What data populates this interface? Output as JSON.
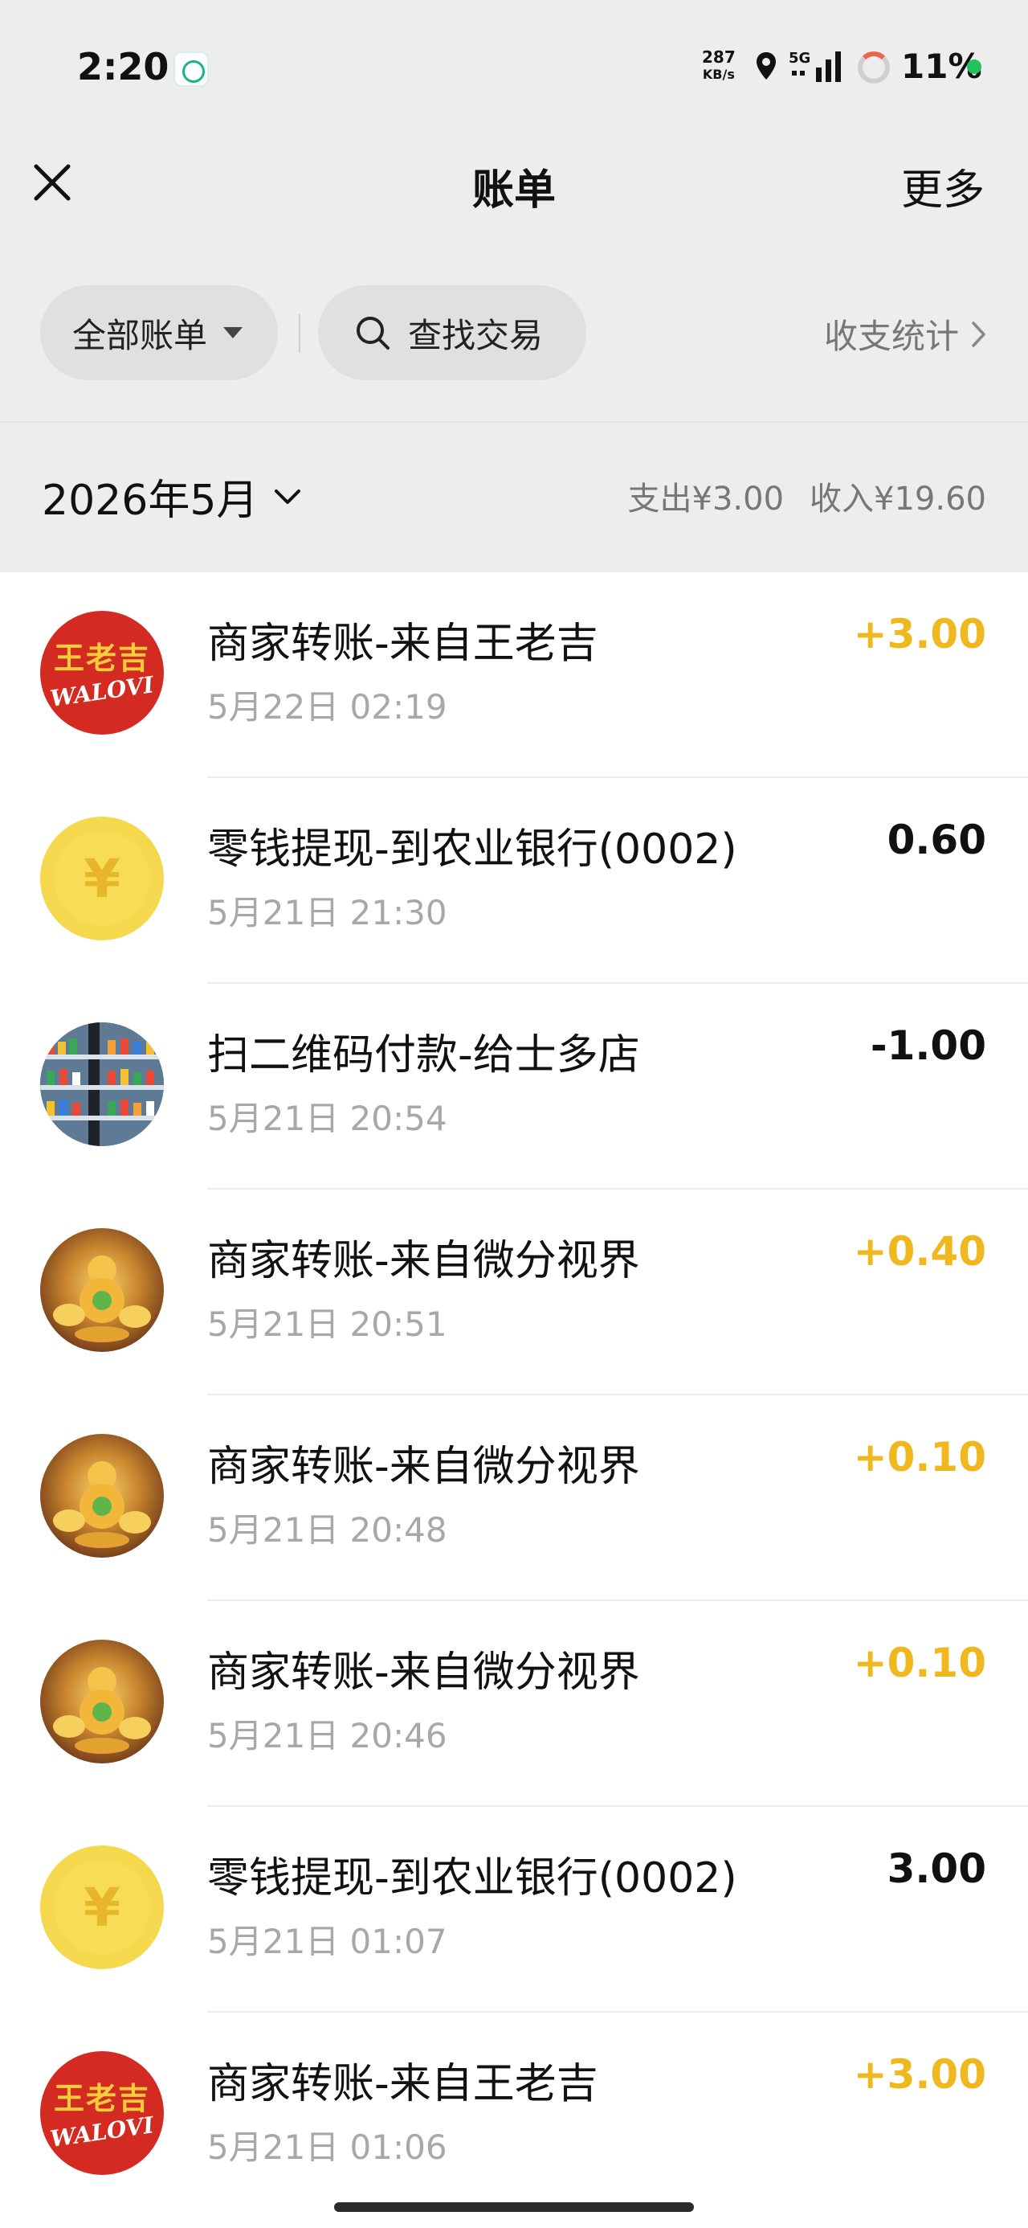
{
  "status_bar": {
    "time": "2:20",
    "net_speed_value": "287",
    "net_speed_unit": "KB/s",
    "signal": "5G",
    "battery": "11%"
  },
  "header": {
    "title": "账单",
    "more_label": "更多"
  },
  "filters": {
    "all_bills_label": "全部账单",
    "search_label": "查找交易",
    "stats_label": "收支统计"
  },
  "summary": {
    "month": "2026年5月",
    "expense": "支出¥3.00",
    "income": "收入¥19.60"
  },
  "transactions": [
    {
      "title": "商家转账-来自王老吉",
      "time": "5月22日 02:19",
      "amount": "+3.00",
      "amount_color": "#f0b81e",
      "avatar": "wanglaoji-logo"
    },
    {
      "title": "零钱提现-到农业银行(0002)",
      "time": "5月21日 21:30",
      "amount": "0.60",
      "amount_color": "#111111",
      "avatar": "yuan-coin"
    },
    {
      "title": "扫二维码付款-给士多店",
      "time": "5月21日 20:54",
      "amount": "-1.00",
      "amount_color": "#111111",
      "avatar": "shop-photo"
    },
    {
      "title": "商家转账-来自微分视界",
      "time": "5月21日 20:51",
      "amount": "+0.40",
      "amount_color": "#f0b81e",
      "avatar": "gold-gourd"
    },
    {
      "title": "商家转账-来自微分视界",
      "time": "5月21日 20:48",
      "amount": "+0.10",
      "amount_color": "#f0b81e",
      "avatar": "gold-gourd"
    },
    {
      "title": "商家转账-来自微分视界",
      "time": "5月21日 20:46",
      "amount": "+0.10",
      "amount_color": "#f0b81e",
      "avatar": "gold-gourd"
    },
    {
      "title": "零钱提现-到农业银行(0002)",
      "time": "5月21日 01:07",
      "amount": "3.00",
      "amount_color": "#111111",
      "avatar": "yuan-coin"
    },
    {
      "title": "商家转账-来自王老吉",
      "time": "5月21日 01:06",
      "amount": "+3.00",
      "amount_color": "#f0b81e",
      "avatar": "wanglaoji-logo"
    }
  ],
  "logos": {
    "wanglaoji_cn": "王老吉",
    "wanglaoji_en": "WALOVI",
    "coin_symbol": "¥"
  }
}
